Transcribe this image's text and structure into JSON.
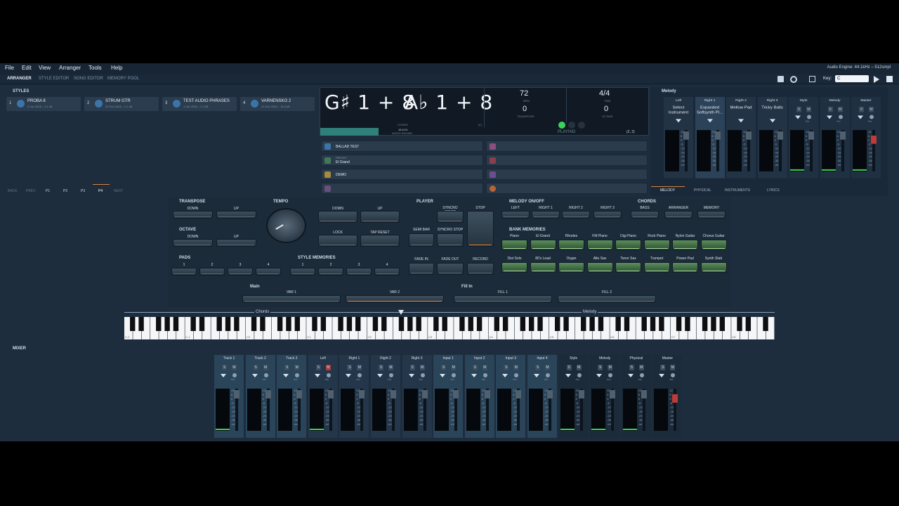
{
  "menu": [
    "File",
    "Edit",
    "View",
    "Arranger",
    "Tools",
    "Help"
  ],
  "tabs": [
    "ARRANGER",
    "STYLE EDITOR",
    "SONG EDITOR",
    "MEMORY POOL"
  ],
  "audio_engine": "Audio Engine: 44.1kHz – 512smpl",
  "key_label": "Key:",
  "key_value": "C",
  "styles_title": "STYLES",
  "styles": [
    {
      "num": "1",
      "name": "PROBA 8",
      "sub": "5 Jan 2026 – 3.1 kB"
    },
    {
      "num": "2",
      "name": "STRUM GTR",
      "sub": "22 Dec 2025 – 2.1 kB"
    },
    {
      "num": "3",
      "name": "TEST AUDIO PHRASES",
      "sub": "1 Jan 2026 – 2.3 kB"
    },
    {
      "num": "4",
      "name": "VARNENSKO 2",
      "sub": "31 Dec 2025 – 18.3 kB"
    }
  ],
  "nav": [
    "BACK",
    "PREV",
    "P1",
    "P2",
    "P3",
    "P4",
    "NEXT"
  ],
  "display": {
    "chord1": "G♯ 1 + 8",
    "chord2": "A♭ 1 + 8",
    "tempo": "72",
    "bpm": "BPM",
    "transpose": "0",
    "transpose_lbl": "TRANSPOSE",
    "sig": "4/4",
    "sig_lbl": "TIME",
    "octave": "0",
    "octave_lbl": "OCTAVE",
    "chord_lbl": "CHORD",
    "load": "16.11%",
    "load_lbl": "AUDIO ENGINE",
    "fi": "(F)",
    "playing": "PLAYING",
    "pos": "(2, 2)"
  },
  "regs_left": [
    "BALLAD TEST",
    "El Grand",
    "DEMO",
    ""
  ],
  "regs_left_sub": [
    "",
    "PRESET",
    "",
    ""
  ],
  "regs_right": [
    "",
    "",
    "",
    "",
    ""
  ],
  "melody": {
    "title": "Melody",
    "tabs": [
      "MELODY",
      "PHYSICAL",
      "INSTRUMENTS",
      "LYRICS"
    ],
    "channels": [
      "Left",
      "Right 1",
      "Right 2",
      "Right 3",
      "Style",
      "Melody",
      "Master"
    ],
    "instruments": [
      "Select Instrument",
      "Expanded Softsynth Pl...",
      "Mellow Pad",
      "Tricky Balls"
    ]
  },
  "controls": {
    "transpose": "TRANSPOSE",
    "octave": "OCTAVE",
    "tempo": "TEMPO",
    "pads": "PADS",
    "style_mem": "STYLE MEMORIES",
    "player": "PLAYER",
    "melody_onoff": "MELODY ON/OFF",
    "chords": "CHORDS",
    "bank_mem": "BANK MEMORIES",
    "down": "DOWN",
    "up": "UP",
    "lock": "LOCK",
    "tap": "TAP RESET",
    "pad_nums": [
      "1",
      "2",
      "3",
      "4"
    ],
    "player_btns": [
      "SYNCRO START",
      "STOP",
      "SEMI BAR",
      "SYNCRO STOP",
      "FADE IN",
      "FADE OUT",
      "RECORD"
    ],
    "melody_btns": [
      "LEFT",
      "RIGHT 1",
      "RIGHT 2",
      "RIGHT 3"
    ],
    "chords_btns": [
      "BASS",
      "ARRANGER",
      "MEMORY"
    ],
    "banks": [
      "Piano",
      "El Grand",
      "Rhodes",
      "FM Piano",
      "Digi Piano",
      "Rock Piano",
      "Nylon Guitar",
      "Chorus Guitar",
      "Dist Solo",
      "80's Lead",
      "Organ",
      "Alto Sax",
      "Tenor Sax",
      "Trumpet",
      "Power Pad",
      "Synth Stab"
    ],
    "main": "Main",
    "fill": "Fill In",
    "vars": [
      "VAR 1",
      "VAR 2",
      "FILL 1",
      "FILL 2"
    ]
  },
  "keyboard": {
    "chords": "Chords",
    "melody": "Melody",
    "octaves": [
      "C-2",
      "C-1",
      "C0",
      "C1",
      "C2",
      "C3",
      "C4",
      "C5",
      "C6",
      "C7",
      "C8"
    ]
  },
  "mixer": {
    "title": "MIXER",
    "channels": [
      "Track 1",
      "Track 2",
      "Track 3",
      "Left",
      "Right 1",
      "Right 2",
      "Right 3",
      "Input 1",
      "Input 2",
      "Input 3",
      "Input 4",
      "Style",
      "Melody",
      "Physical",
      "Master"
    ],
    "s": "S",
    "m": "M",
    "pan": "Pan",
    "scale": [
      "12",
      "6",
      "0",
      "-6",
      "-12",
      "-18",
      "-24",
      "-36",
      "-inf"
    ]
  }
}
